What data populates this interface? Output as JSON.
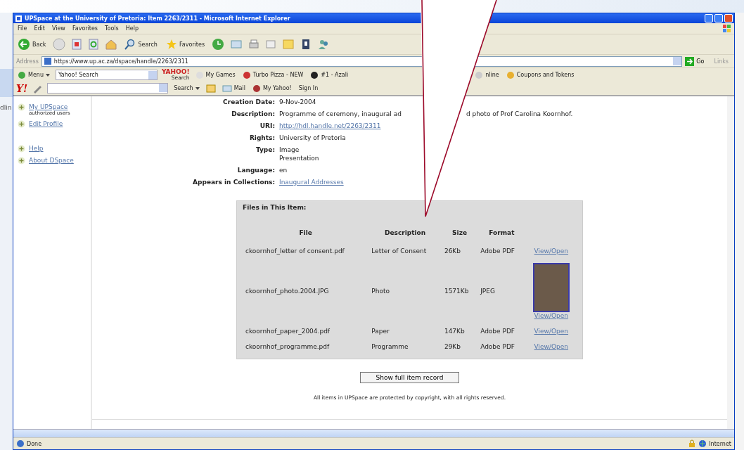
{
  "background_fragment": "dlin",
  "window": {
    "title": "UPSpace at the University of Pretoria: Item 2263/2311 - Microsoft Internet Explorer"
  },
  "menu": [
    "File",
    "Edit",
    "View",
    "Favorites",
    "Tools",
    "Help"
  ],
  "toolbar": {
    "back": "Back",
    "search": "Search",
    "favorites": "Favorites"
  },
  "address_bar": {
    "label": "Address",
    "value": "https://www.up.ac.za/dspace/handle/2263/2311",
    "go": "Go",
    "links": "Links"
  },
  "yahoo_toolbar": {
    "menu": "Menu",
    "search_value": "Yahoo! Search",
    "logo_top": "YAHOO!",
    "logo_bottom": "Search",
    "items": [
      "My Games",
      "Turbo Pizza - NEW",
      "#1 - Azali",
      "nline",
      "Coupons and Tokens"
    ],
    "logo": "Y!",
    "search_button": "Search",
    "mail": "Mail",
    "my_yahoo": "My Yahoo!",
    "sign_in": "Sign In"
  },
  "sidebar": {
    "items": [
      {
        "label": "My UPSpace",
        "note": "authorized users"
      },
      {
        "label": "Edit Profile"
      },
      {
        "label": "Help"
      },
      {
        "label": "About DSpace"
      }
    ]
  },
  "metadata": [
    {
      "label": "Creation Date:",
      "values": [
        "9-Nov-2004"
      ],
      "kind": "text"
    },
    {
      "label": "Description:",
      "values": [
        "Programme of ceremony, inaugural ad",
        "d photo of Prof Carolina Koornhof."
      ],
      "kind": "split"
    },
    {
      "label": "URI:",
      "values": [
        "http://hdl.handle.net/2263/2311"
      ],
      "kind": "link"
    },
    {
      "label": "Rights:",
      "values": [
        "University of Pretoria"
      ],
      "kind": "text"
    },
    {
      "label": "Type:",
      "values": [
        "Image",
        "Presentation"
      ],
      "kind": "text"
    },
    {
      "label": "Language:",
      "values": [
        "en"
      ],
      "kind": "text"
    },
    {
      "label": "Appears in Collections:",
      "values": [
        "Inaugural Addresses"
      ],
      "kind": "link"
    }
  ],
  "files": {
    "title": "Files in This Item:",
    "columns": [
      "File",
      "Description",
      "Size",
      "Format"
    ],
    "rows": [
      {
        "file": "ckoornhof_letter of consent.pdf",
        "description": "Letter of Consent",
        "size": "26Kb",
        "format": "Adobe PDF",
        "link": "View/Open",
        "kind": "link"
      },
      {
        "file": "ckoornhof_photo.2004.JPG",
        "description": "Photo",
        "size": "1571Kb",
        "format": "JPEG",
        "link": "View/Open",
        "kind": "thumbnail"
      },
      {
        "file": "ckoornhof_paper_2004.pdf",
        "description": "Paper",
        "size": "147Kb",
        "format": "Adobe PDF",
        "link": "View/Open",
        "kind": "link"
      },
      {
        "file": "ckoornhof_programme.pdf",
        "description": "Programme",
        "size": "29Kb",
        "format": "Adobe PDF",
        "link": "View/Open",
        "kind": "link"
      }
    ]
  },
  "full_record_button": "Show full item record",
  "footer": "All items in UPSpace are protected by copyright, with all rights reserved.",
  "status_bar": {
    "text": "Done",
    "zone": "Internet"
  }
}
